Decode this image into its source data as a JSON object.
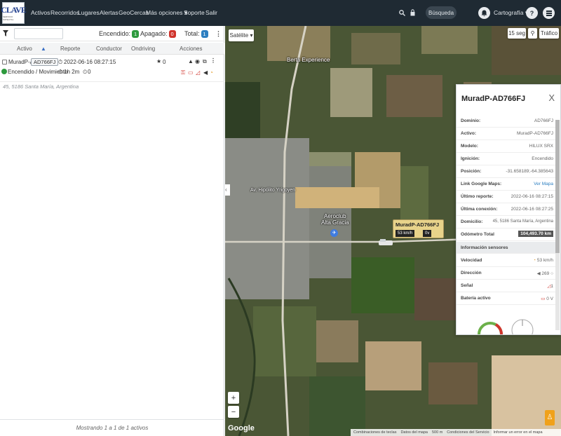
{
  "logo": {
    "text": "CLAVE",
    "subtext": "SERVICIO SATELITAL"
  },
  "nav": {
    "items": [
      "Activos",
      "Recorridos",
      "Lugares",
      "Alertas",
      "GeoCercas",
      "Más opciones",
      "Soporte",
      "Salir"
    ],
    "search_label": "Búsqueda",
    "cartography_label": "Cartografía"
  },
  "counts": {
    "on_label": "Encendido:",
    "on_value": "1",
    "off_label": "Apagado:",
    "off_value": "0",
    "total_label": "Total:",
    "total_value": "1"
  },
  "table": {
    "headers": [
      "Activo",
      "Reporte",
      "Conductor",
      "Ondriving",
      "Acciones"
    ],
    "row": {
      "name": "MuradP-A...",
      "plate": "AD766FJ",
      "report": "2022-06-16 08:27:15",
      "star_count": "0",
      "status": "Encendido / Movimiento",
      "duration": "1h 2m",
      "speed": "0",
      "address": "45, 5186 Santa María, Argentina"
    },
    "footer": "Mostrando 1 a 1 de 1 activos"
  },
  "map": {
    "type_label": "Satélite",
    "refresh_label": "15 seg",
    "traffic_label": "Tráfico",
    "labels": {
      "berta": "Berta Experience",
      "road": "Av. Hipólito Yrigoyen",
      "aeroclub": "Aeroclub\nAlta Gracia"
    },
    "marker": {
      "title": "MuradP-AD766FJ",
      "speed": "53 km/h",
      "battery": "0v"
    },
    "zoom_in": "+",
    "zoom_out": "−",
    "google": "Google",
    "attribution": [
      "Combinaciones de teclas",
      "Datos del mapa",
      "500 m",
      "Condiciones del Servicio",
      "Informar un error en el mapa"
    ]
  },
  "info": {
    "title": "MuradP-AD766FJ",
    "close": "X",
    "rows": [
      {
        "k": "Dominio:",
        "v": "AD766FJ"
      },
      {
        "k": "Activo:",
        "v": "MuradP-AD766FJ"
      },
      {
        "k": "Modelo:",
        "v": "HILUX SRX"
      },
      {
        "k": "Ignición:",
        "v": "Encendido"
      },
      {
        "k": "Posición:",
        "v": "-31.658189;-64.385643"
      },
      {
        "k": "Link Google Maps:",
        "v": "Ver Mapa"
      },
      {
        "k": "Último reporte:",
        "v": "2022-06-16 08:27:15"
      },
      {
        "k": "Última conexión:",
        "v": "2022-06-16 08:27:25"
      },
      {
        "k": "Domicilio:",
        "v": "45, 5186 Santa María, Argentina"
      },
      {
        "k": "Odómetro Total",
        "v": "104,493.70 km"
      }
    ],
    "sensors_title": "Información sensores",
    "sensors": [
      {
        "k": "Velocidad",
        "v": "53 km/h"
      },
      {
        "k": "Dirección",
        "v": "269"
      },
      {
        "k": "Señal",
        "v": "1"
      },
      {
        "k": "Batería activo",
        "v": "0 V"
      }
    ]
  },
  "colors": {
    "nav": "#1f2a33",
    "on": "#2e9a3e",
    "off": "#d0342c",
    "total": "#2d7fc1",
    "marker": "#e8d38a"
  }
}
